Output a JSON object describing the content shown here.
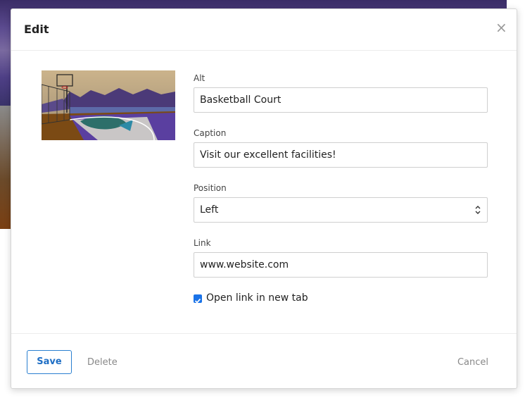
{
  "modal": {
    "title": "Edit",
    "close_icon": "close-icon"
  },
  "image": {
    "description_icon": "basketball-court-thumbnail"
  },
  "form": {
    "alt": {
      "label": "Alt",
      "value": "Basketball Court"
    },
    "caption": {
      "label": "Caption",
      "value": "Visit our excellent facilities!"
    },
    "position": {
      "label": "Position",
      "value": "Left"
    },
    "link": {
      "label": "Link",
      "value": "www.website.com"
    },
    "new_tab": {
      "label": "Open link in new tab",
      "checked": true
    }
  },
  "footer": {
    "save_label": "Save",
    "delete_label": "Delete",
    "cancel_label": "Cancel"
  },
  "colors": {
    "accent": "#1a73e8",
    "save_border": "#2a7fd0",
    "muted_text": "#888888"
  }
}
